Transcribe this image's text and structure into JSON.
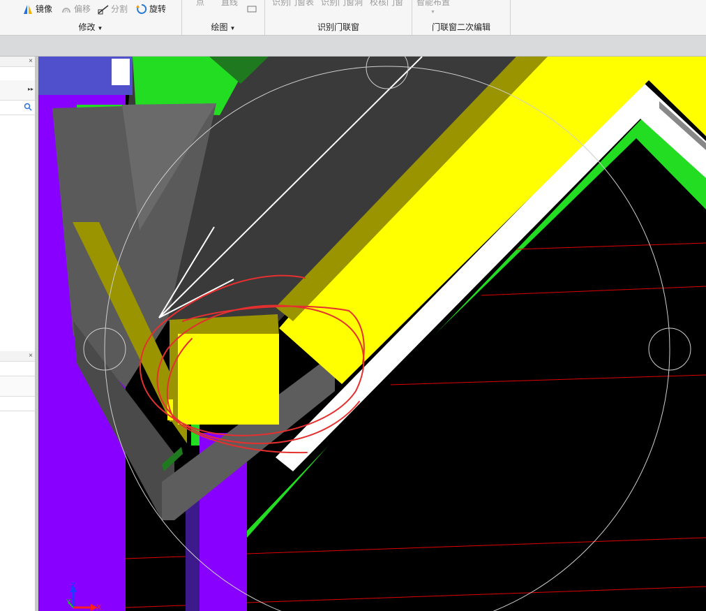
{
  "ribbon": {
    "modify": {
      "label": "修改",
      "buttons": {
        "mirror": "镜像",
        "offset": "偏移",
        "split": "分割",
        "rotate": "旋转"
      }
    },
    "draw": {
      "label": "绘图",
      "buttons": {
        "point": "点",
        "line": "直线"
      }
    },
    "identify": {
      "label": "识别门联窗",
      "buttons": {
        "table": "识别门窗表",
        "hole": "识别门窗洞",
        "check": "校核门窗"
      }
    },
    "edit": {
      "label": "门联窗二次编辑",
      "buttons": {
        "smart_layout": "智能布置"
      }
    }
  },
  "left_panel": {
    "close_symbol": "×",
    "more_symbol": "▸▸"
  },
  "axis": {
    "z": "Z",
    "y": "Y",
    "x": "X"
  },
  "colors": {
    "purple": "#8800ff",
    "green": "#22dd22",
    "yellow": "#ffff00",
    "olive": "#9a9400",
    "dark_gray": "#3a3a3a",
    "gray": "#606060",
    "red_annotation": "#e63030",
    "background": "#000000"
  },
  "icons": {
    "mirror": "mirror-icon",
    "offset": "offset-icon",
    "split": "split-icon",
    "rotate": "rotate-icon",
    "search": "search-icon",
    "rectangle": "rectangle-icon"
  }
}
